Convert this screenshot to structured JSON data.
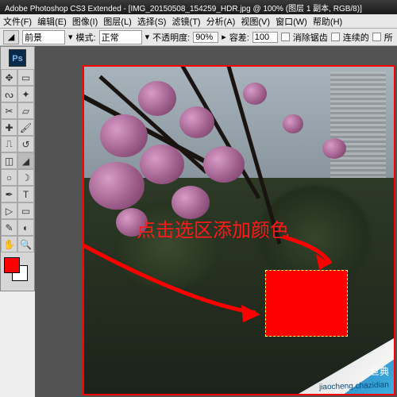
{
  "title": "Adobe Photoshop CS3 Extended - [IMG_20150508_154259_HDR.jpg @ 100% (图层 1 副本, RGB/8)]",
  "menu": {
    "file": "文件(F)",
    "edit": "编辑(E)",
    "image": "图像(I)",
    "layer": "图层(L)",
    "select": "选择(S)",
    "filter": "滤镜(T)",
    "analysis": "分析(A)",
    "view": "视图(V)",
    "window": "窗口(W)",
    "help": "帮助(H)"
  },
  "toolbar": {
    "fill_label": "前景",
    "mode_label": "模式:",
    "mode_value": "正常",
    "opacity_label": "不透明度:",
    "opacity_value": "90%",
    "tolerance_label": "容差:",
    "tolerance_value": "100",
    "antialias_label": "消除锯齿",
    "contiguous_label": "连续的",
    "all_layers_label": "所"
  },
  "logo": "Ps",
  "swatches": {
    "fg": "#ff0000",
    "bg": "#ffffff"
  },
  "annotation": {
    "text": "点击选区添加颜色"
  },
  "watermark": {
    "brand": "世典",
    "sub": "jiaocheng.chazidian"
  },
  "tools": [
    {
      "name": "move",
      "g": "✥"
    },
    {
      "name": "marquee",
      "g": "▭"
    },
    {
      "name": "lasso",
      "g": "ᔓ"
    },
    {
      "name": "wand",
      "g": "✦"
    },
    {
      "name": "crop",
      "g": "✂"
    },
    {
      "name": "slice",
      "g": "▱"
    },
    {
      "name": "heal",
      "g": "✚"
    },
    {
      "name": "brush",
      "g": "🖌"
    },
    {
      "name": "stamp",
      "g": "⎍"
    },
    {
      "name": "history",
      "g": "↺"
    },
    {
      "name": "eraser",
      "g": "◫"
    },
    {
      "name": "bucket",
      "g": "◢",
      "sel": true
    },
    {
      "name": "blur",
      "g": "○"
    },
    {
      "name": "dodge",
      "g": "☽"
    },
    {
      "name": "pen",
      "g": "✒"
    },
    {
      "name": "type",
      "g": "T"
    },
    {
      "name": "path",
      "g": "▷"
    },
    {
      "name": "shape",
      "g": "▭"
    },
    {
      "name": "notes",
      "g": "✎"
    },
    {
      "name": "eyedrop",
      "g": "◐"
    },
    {
      "name": "hand",
      "g": "✋"
    },
    {
      "name": "zoom",
      "g": "🔍"
    }
  ]
}
